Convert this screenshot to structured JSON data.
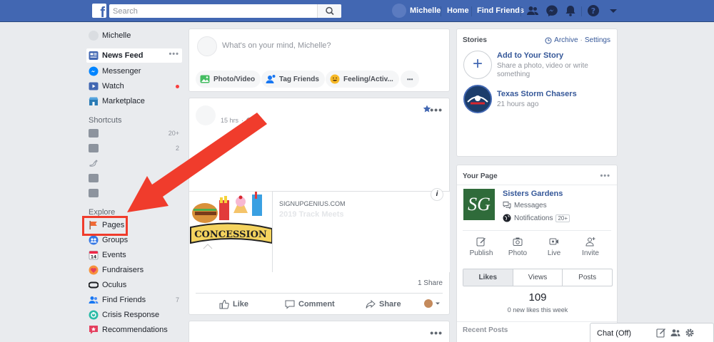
{
  "topbar": {
    "logo": "f",
    "search_placeholder": "Search",
    "user": "Michelle",
    "home": "Home",
    "find_friends": "Find Friends"
  },
  "sidebar": {
    "profile": "Michelle",
    "main": [
      {
        "label": "News Feed",
        "icon": "news-feed-icon",
        "color": "#4267b2"
      },
      {
        "label": "Messenger",
        "icon": "messenger-icon",
        "color": "#0084ff"
      },
      {
        "label": "Watch",
        "icon": "watch-icon",
        "color": "#4267b2"
      },
      {
        "label": "Marketplace",
        "icon": "marketplace-icon",
        "color": "#2a7bb5"
      }
    ],
    "shortcuts_title": "Shortcuts",
    "shortcut_counts": [
      "20+",
      "2"
    ],
    "explore_title": "Explore",
    "explore": [
      {
        "label": "Pages",
        "icon": "flag-icon",
        "color": "#f06a35"
      },
      {
        "label": "Groups",
        "icon": "groups-icon",
        "color": "#3578e5"
      },
      {
        "label": "Events",
        "icon": "calendar-icon",
        "color": "#f02849"
      },
      {
        "label": "Fundraisers",
        "icon": "fundraiser-icon",
        "color": "#f7923b"
      },
      {
        "label": "Oculus",
        "icon": "oculus-icon",
        "color": "#1c1e21"
      },
      {
        "label": "Find Friends",
        "icon": "friends-icon",
        "color": "#1877f2",
        "count": "7"
      },
      {
        "label": "Crisis Response",
        "icon": "crisis-icon",
        "color": "#2abba7"
      },
      {
        "label": "Recommendations",
        "icon": "recommendations-icon",
        "color": "#e4405f"
      }
    ]
  },
  "composer": {
    "prompt": "What's on your mind, Michelle?",
    "photo_video": "Photo/Video",
    "tag_friends": "Tag Friends",
    "feeling": "Feeling/Activ...",
    "more": "•••"
  },
  "post": {
    "time": "15 hrs",
    "link_domain": "SIGNUPGENIUS.COM",
    "link_title": "2019 Track Meets",
    "image_text": "CONCESSION",
    "share_count": "1 Share",
    "like": "Like",
    "comment": "Comment",
    "share": "Share"
  },
  "stories": {
    "title": "Stories",
    "archive": "Archive",
    "settings": "Settings",
    "add_title": "Add to Your Story",
    "add_sub": "Share a photo, video or write something",
    "story_name": "Texas Storm Chasers",
    "story_time": "21 hours ago"
  },
  "your_page": {
    "title": "Your Page",
    "page_name": "Sisters Gardens",
    "logo_text": "SG",
    "messages": "Messages",
    "notifications": "Notifications",
    "notif_badge": "20+",
    "actions": [
      "Publish",
      "Photo",
      "Live",
      "Invite"
    ],
    "tabs": [
      "Likes",
      "Views",
      "Posts"
    ],
    "likes_count": "109",
    "likes_sub": "0 new likes this week",
    "recent_posts": "Recent Posts"
  },
  "chat": {
    "label": "Chat (Off)"
  },
  "colors": {
    "brand": "#4267b2",
    "highlight": "#f03c2c"
  }
}
